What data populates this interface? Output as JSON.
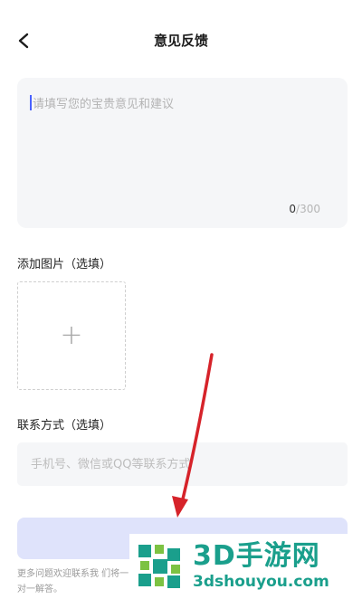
{
  "header": {
    "title": "意见反馈",
    "back_icon": "chevron-left-icon"
  },
  "feedback": {
    "placeholder": "请填写您的宝贵意见和建议",
    "count_current": "0",
    "count_max": "/300"
  },
  "image_section": {
    "label": "添加图片（选填）",
    "add_icon": "plus-icon"
  },
  "contact_section": {
    "label": "联系方式（选填）",
    "placeholder": "手机号、微信或QQ等联系方式"
  },
  "submit": {
    "label": ""
  },
  "footer": {
    "note": "更多问题欢迎联系我 们将一对一解答。"
  },
  "overlay": {
    "annotation": "red-arrow",
    "watermark_main": "3D手游网",
    "watermark_sub": "3dshouyou.com"
  },
  "colors": {
    "accent": "#4a62ff",
    "submit_bg": "#dfe3fb",
    "arrow": "#d6232a",
    "watermark": "#1a9f8c"
  }
}
